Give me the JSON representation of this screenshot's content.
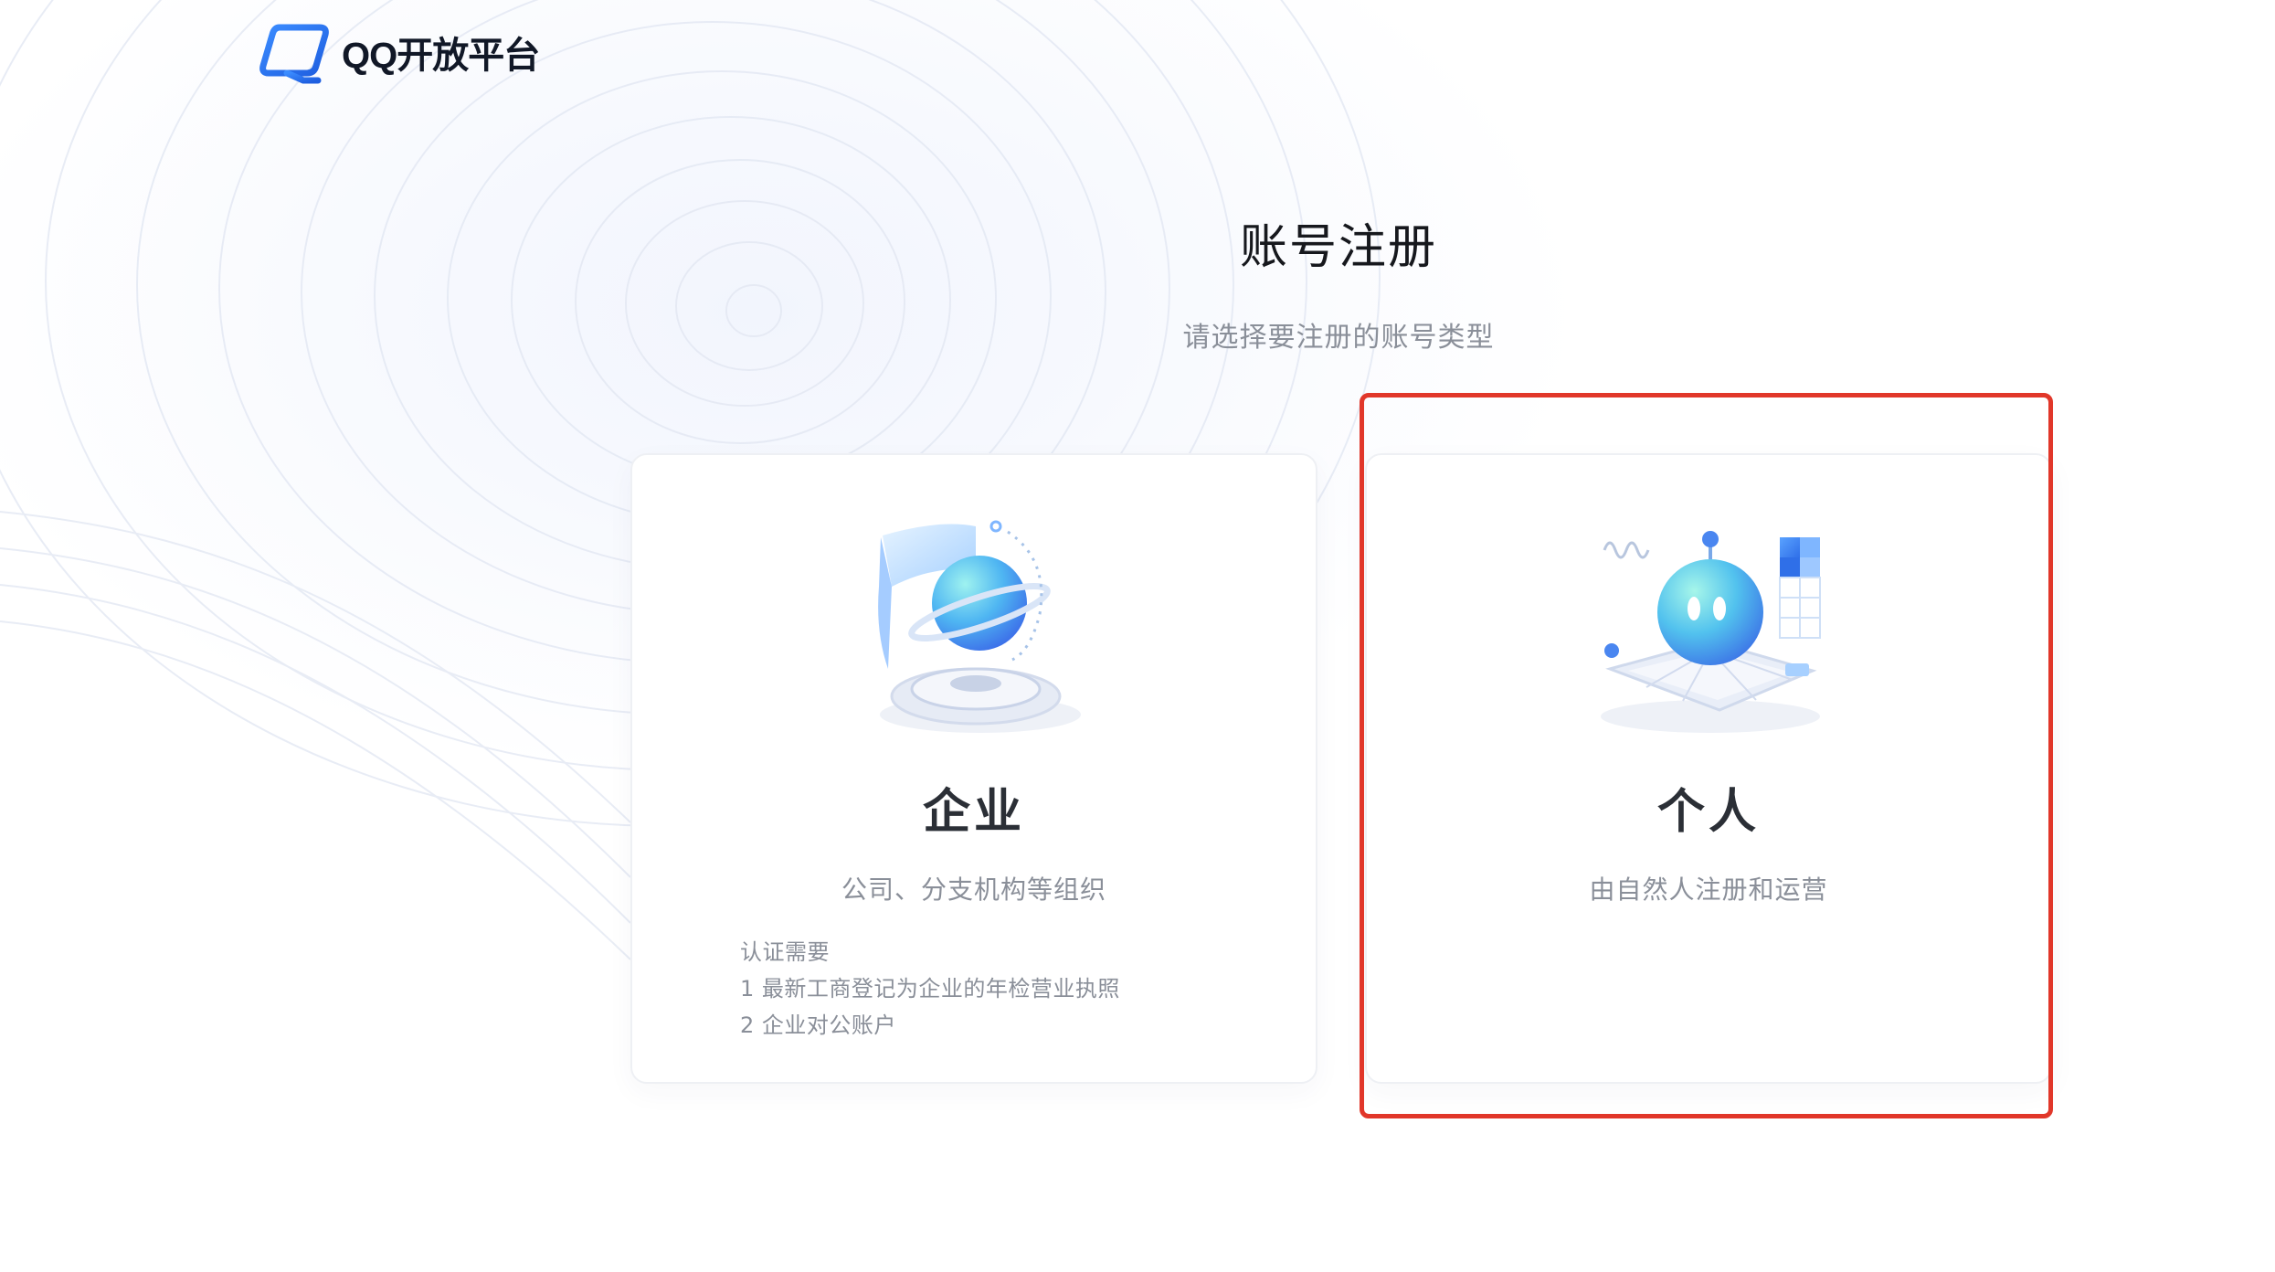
{
  "header": {
    "logo_text": "QQ开放平台"
  },
  "page": {
    "title": "账号注册",
    "subtitle": "请选择要注册的账号类型"
  },
  "cards": {
    "enterprise": {
      "title": "企业",
      "description": "公司、分支机构等组织",
      "requirements_heading": "认证需要",
      "requirements": [
        "1  最新工商登记为企业的年检营业执照",
        "2  企业对公账户"
      ],
      "icon": "planet-globe-icon"
    },
    "personal": {
      "title": "个人",
      "description": "由自然人注册和运营",
      "icon": "robot-globe-icon"
    }
  },
  "colors": {
    "accent": "#2f7cf6",
    "highlight_border": "#e1372a",
    "text_primary": "#16181d",
    "text_secondary": "#8a8f99"
  }
}
